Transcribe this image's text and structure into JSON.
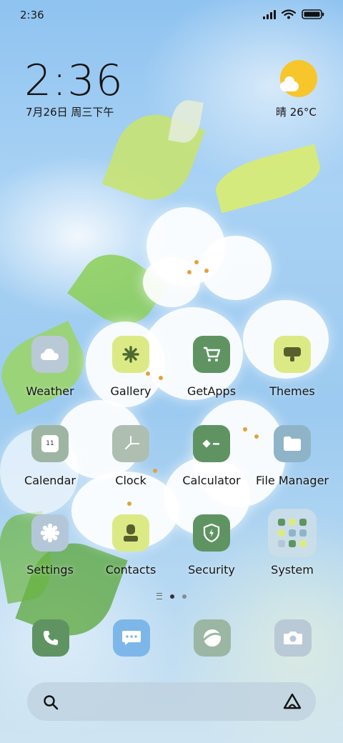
{
  "status_bar": {
    "time": "2:36"
  },
  "clock_widget": {
    "time": "2:36",
    "date": "7月26日 周三下午"
  },
  "weather_widget": {
    "condition_text": "晴 26°C",
    "icon": "sun-cloud-icon"
  },
  "apps": [
    {
      "label": "Weather",
      "icon": "cloud-icon",
      "color": "#b9c9d6"
    },
    {
      "label": "Gallery",
      "icon": "flower-icon",
      "color": "#dcea86"
    },
    {
      "label": "GetApps",
      "icon": "cart-icon",
      "color": "#5f9462"
    },
    {
      "label": "Themes",
      "icon": "brush-icon",
      "color": "#dcea86"
    },
    {
      "label": "Calendar",
      "icon": "calendar-icon",
      "color": "#9fb5a4",
      "badge": "11"
    },
    {
      "label": "Clock",
      "icon": "clock-icon",
      "color": "#aebfb2"
    },
    {
      "label": "Calculator",
      "icon": "calculator-icon",
      "color": "#5f9462"
    },
    {
      "label": "File Manager",
      "icon": "folder-icon",
      "color": "#8fb4c8"
    },
    {
      "label": "Settings",
      "icon": "gear-icon",
      "color": "#b4c7d8"
    },
    {
      "label": "Contacts",
      "icon": "person-icon",
      "color": "#dcea86"
    },
    {
      "label": "Security",
      "icon": "shield-icon",
      "color": "#5f9462"
    },
    {
      "label": "System",
      "icon": "folder-grid-icon",
      "color": "#c6dbe6"
    }
  ],
  "page_indicator": {
    "pages": 2,
    "active": 0
  },
  "dock": [
    {
      "name": "phone",
      "icon": "phone-icon",
      "color": "#5f9462"
    },
    {
      "name": "messages",
      "icon": "message-icon",
      "color": "#7db7ea"
    },
    {
      "name": "browser",
      "icon": "browser-icon",
      "color": "#9bb7a3"
    },
    {
      "name": "camera",
      "icon": "camera-icon",
      "color": "#b9c9d6"
    }
  ],
  "search_bar": {
    "left_icon": "search-icon",
    "right_icon": "assistant-icon"
  }
}
